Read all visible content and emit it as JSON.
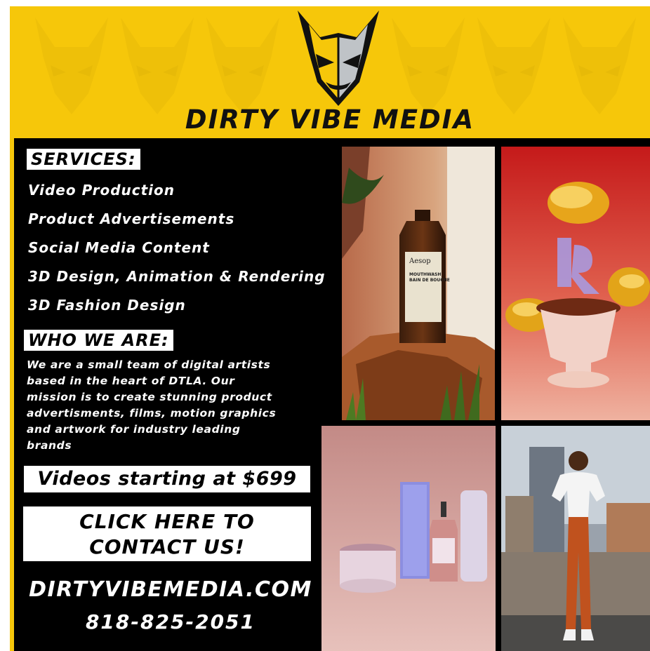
{
  "brand": {
    "name": "DIRTY VIBE MEDIA"
  },
  "services": {
    "heading": "SERVICES:",
    "items": [
      "Video Production",
      "Product Advertisements",
      "Social Media Content",
      "3D Design, Animation & Rendering",
      "3D Fashion Design"
    ]
  },
  "about": {
    "heading": "WHO WE ARE:",
    "lines": [
      "We are a small team of digital artists",
      "based in the heart of DTLA. Our",
      "mission is to create stunning product",
      "advertisments, films, motion graphics",
      "and artwork for industry leading",
      "brands"
    ]
  },
  "pricing": {
    "label": "Videos starting at $699"
  },
  "cta": {
    "line1": "CLICK HERE TO",
    "line2": "CONTACT US!"
  },
  "contact": {
    "website": "DIRTYVIBEMEDIA.COM",
    "phone": "818-825-2051"
  },
  "photos": {
    "bottle_brand": "Aesop",
    "bottle_line1": "MOUTHWASH",
    "bottle_line2": "BAIN DE BOUCHE"
  },
  "colors": {
    "accent_yellow": "#f6c70a",
    "background": "#000000",
    "panel": "#ffffff"
  }
}
